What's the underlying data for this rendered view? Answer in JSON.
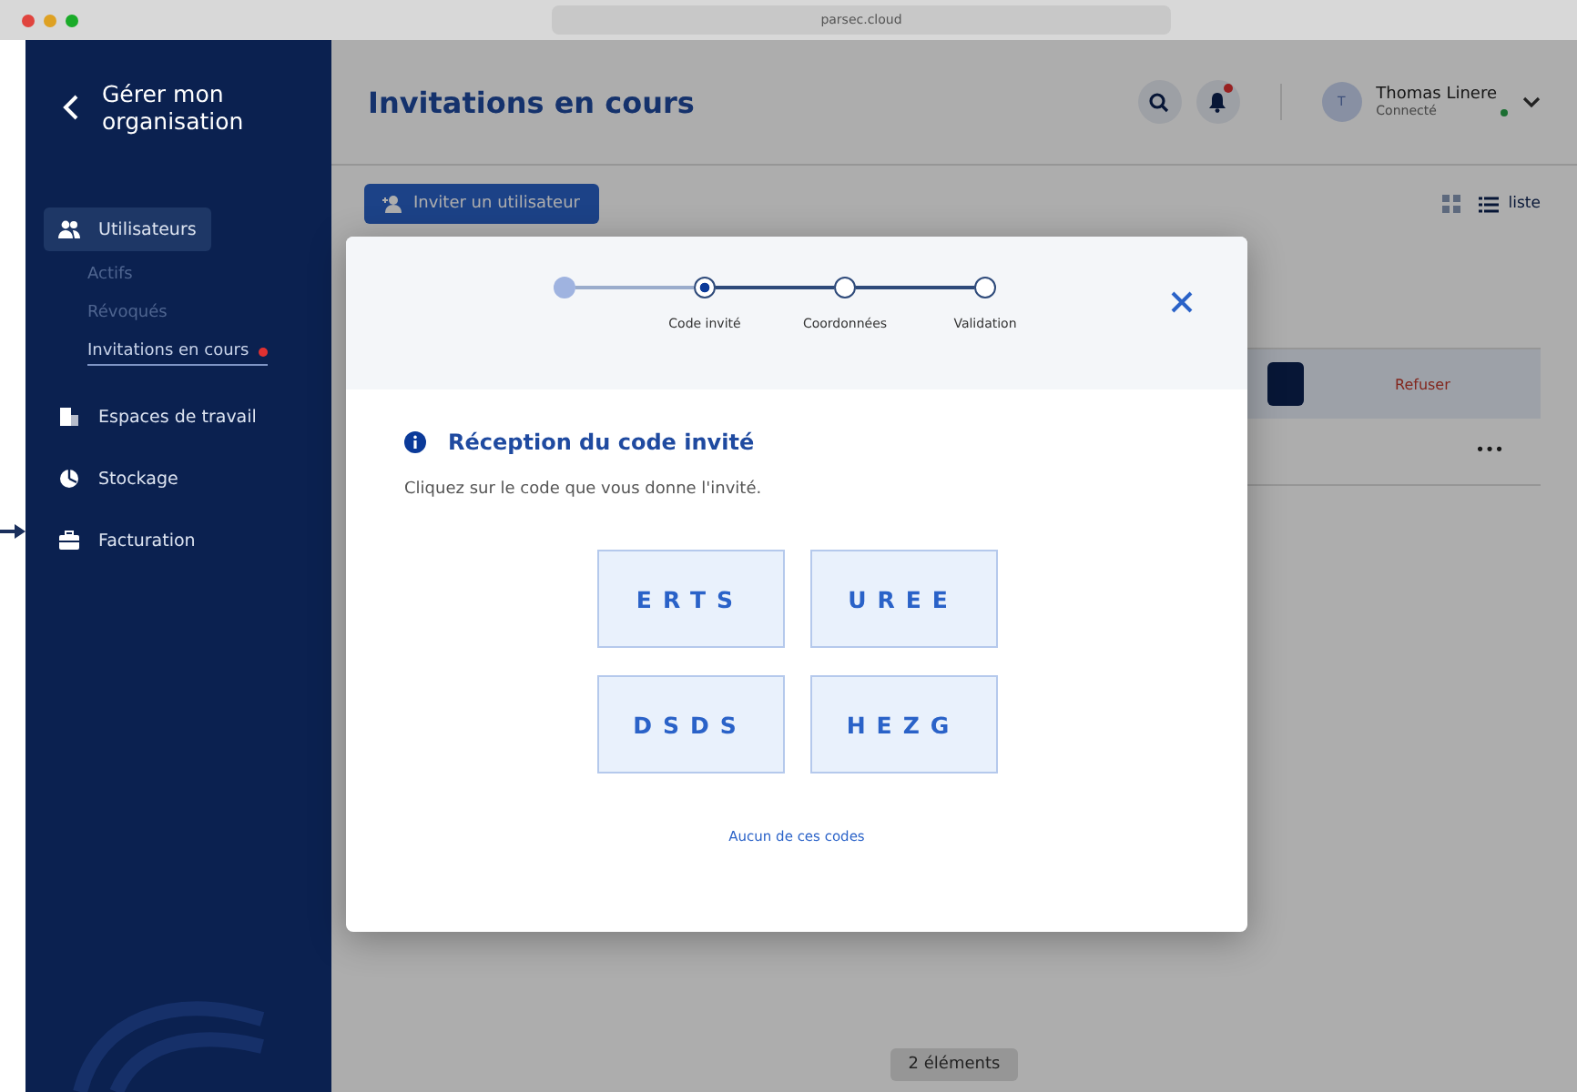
{
  "browser": {
    "address": "parsec.cloud"
  },
  "sidebar": {
    "back_title": "Gérer mon organisation",
    "items": [
      {
        "label": "Utilisateurs",
        "kind": "users",
        "selected": true,
        "children": [
          {
            "label": "Actifs",
            "selected": false,
            "badge": false
          },
          {
            "label": "Révoqués",
            "selected": false,
            "badge": false
          },
          {
            "label": "Invitations en cours",
            "selected": true,
            "badge": true
          }
        ]
      },
      {
        "label": "Espaces de travail",
        "kind": "workspaces",
        "selected": false
      },
      {
        "label": "Stockage",
        "kind": "storage",
        "selected": false
      },
      {
        "label": "Facturation",
        "kind": "billing",
        "selected": false
      }
    ]
  },
  "header": {
    "title": "Invitations en cours",
    "user": {
      "name": "Thomas Linere",
      "initial": "T",
      "status": "Connecté",
      "online": true
    },
    "notification": true
  },
  "toolbar": {
    "invite_button": "Inviter un utilisateur",
    "view_label": "liste"
  },
  "background_row": {
    "reject": "Refuser",
    "more": "•••"
  },
  "footer": {
    "count": "2 éléments"
  },
  "modal": {
    "steps": [
      {
        "completed": true,
        "selected": false
      },
      {
        "label": "Code invité",
        "completed": false,
        "selected": true
      },
      {
        "label": "Coordonnées",
        "completed": false,
        "selected": false
      },
      {
        "label": "Validation",
        "completed": false,
        "selected": false
      }
    ],
    "title": "Réception du code invité",
    "instruction": "Cliquez sur le code que vous donne l'invité.",
    "codes": [
      "ERTS",
      "UREE",
      "DSDS",
      "HEZG"
    ],
    "none_link": "Aucun de ces codes"
  }
}
